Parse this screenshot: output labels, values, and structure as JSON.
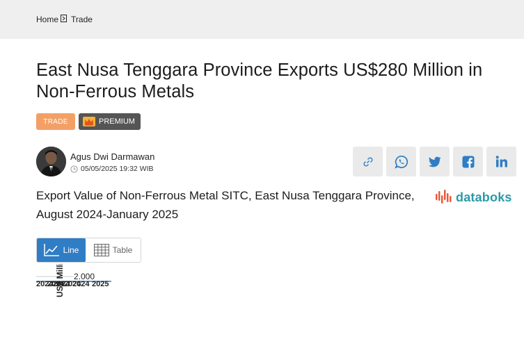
{
  "breadcrumb": {
    "home": "Home",
    "current": "Trade",
    "separator_icon": "chevron-right-icon"
  },
  "article": {
    "title": "East Nusa Tenggara Province Exports US$280 Million in Non-Ferrous Metals",
    "category": "TRADE",
    "premium": "PREMIUM",
    "author": "Agus Dwi Darmawan",
    "date": "05/05/2025 19:32 WIB"
  },
  "share": {
    "buttons": [
      {
        "name": "copy-link",
        "icon": "link-icon"
      },
      {
        "name": "whatsapp",
        "icon": "whatsapp-icon"
      },
      {
        "name": "twitter",
        "icon": "twitter-icon"
      },
      {
        "name": "facebook",
        "icon": "facebook-icon"
      },
      {
        "name": "linkedin",
        "icon": "linkedin-icon"
      }
    ]
  },
  "chart_section": {
    "title": "Export Value of Non-Ferrous Metal SITC, East Nusa Tenggara Province, August 2024-January 2025",
    "brand": "databoks",
    "view_line": "Line",
    "view_table": "Table"
  },
  "colors": {
    "topbar": "#efefef",
    "trade_badge": "#f3a066",
    "premium_badge": "#555555",
    "line_toggle": "#2f7dc4",
    "brand": "#2b9aa8",
    "share_bg": "#eaeaea"
  },
  "chart_data": {
    "type": "line",
    "ylabel": "US$ Milli",
    "yticks": [
      "2.000"
    ],
    "xtick_labels": [
      "2024",
      "2024",
      "2024",
      "2024",
      "2024",
      "2025"
    ],
    "note": ""
  }
}
